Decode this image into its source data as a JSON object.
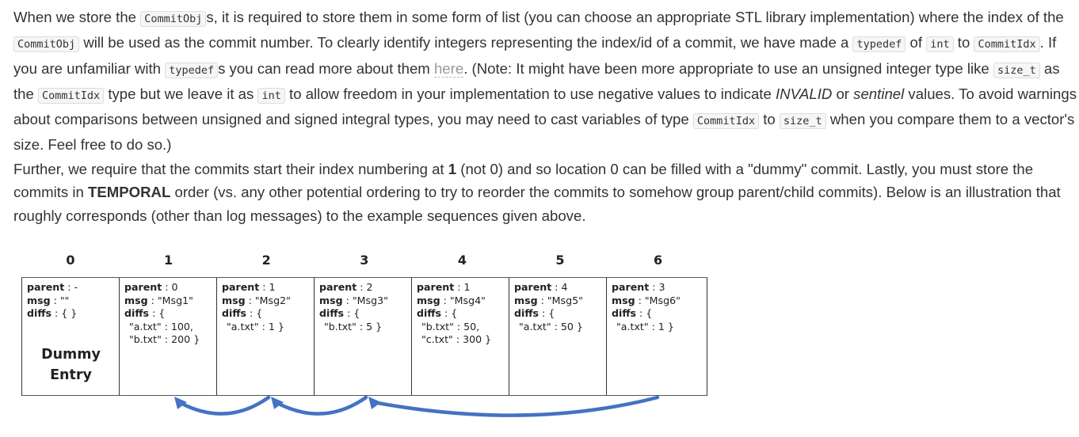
{
  "paragraph1": {
    "s1": "When we store the ",
    "c1": "CommitObj",
    "s2": "s, it is required to store them in some form of list (you can choose an appropriate STL library implementation) where the index of the ",
    "c2": "CommitObj",
    "s3": " will be used as the commit number. To clearly identify integers representing the index/id of a commit, we have made a ",
    "c3": "typedef",
    "s4": " of ",
    "c4": "int",
    "s5": " to ",
    "c5": "CommitIdx",
    "s6": ". If you are unfamiliar with ",
    "c6": "typedef",
    "s7": "s you can read more about them ",
    "link": "here",
    "s8": ". (Note: It might have been more appropriate to use an unsigned integer type like ",
    "c7": "size_t",
    "s9": " as the ",
    "c8": "CommitIdx",
    "s10": " type but we leave it as ",
    "c9": "int",
    "s11": " to allow freedom in your implementation to use negative values to indicate ",
    "i1": "INVALID",
    "s12": " or ",
    "i2": "sentinel",
    "s13": " values. To avoid warnings about comparisons between unsigned and signed integral types, you may need to cast variables of type ",
    "c10": "CommitIdx",
    "s14": " to ",
    "c11": "size_t",
    "s15": " when you compare them to a vector's size. Feel free to do so.)"
  },
  "paragraph2": {
    "s1": "Further, we require that the commits start their index numbering at ",
    "b1": "1",
    "s2": " (not 0) and so location 0 can be filled with a \"dummy\" commit. Lastly, you must store the commits in ",
    "b2": "TEMPORAL",
    "s3": " order (vs. any other potential ordering to try to reorder the commits to somehow group parent/child commits). Below is an illustration that roughly corresponds (other than log messages) to the example sequences given above."
  },
  "diagram": {
    "labels": {
      "parent": "parent",
      "msg": "msg",
      "diffs": "diffs",
      "sep": " : "
    },
    "arrow_color": "#4472c4",
    "commits": [
      {
        "index": "0",
        "parent": "-",
        "msg": "\"\"",
        "diffs_open": "{ }",
        "diffs": [],
        "note": [
          "Dummy",
          "Entry"
        ]
      },
      {
        "index": "1",
        "parent": "0",
        "msg": "\"Msg1\"",
        "diffs_open": "{",
        "diffs": [
          "\"a.txt\" : 100,",
          "\"b.txt\" : 200 }"
        ]
      },
      {
        "index": "2",
        "parent": "1",
        "msg": "\"Msg2\"",
        "diffs_open": "{",
        "diffs": [
          "\"a.txt\" : 1 }"
        ]
      },
      {
        "index": "3",
        "parent": "2",
        "msg": "\"Msg3\"",
        "diffs_open": "{",
        "diffs": [
          "\"b.txt\" : 5 }"
        ]
      },
      {
        "index": "4",
        "parent": "1",
        "msg": "\"Msg4\"",
        "diffs_open": "{",
        "diffs": [
          "\"b.txt\" : 50,",
          "\"c.txt\" : 300 }"
        ]
      },
      {
        "index": "5",
        "parent": "4",
        "msg": "\"Msg5\"",
        "diffs_open": "{",
        "diffs": [
          "\"a.txt\" : 50 }"
        ]
      },
      {
        "index": "6",
        "parent": "3",
        "msg": "\"Msg6\"",
        "diffs_open": "{",
        "diffs": [
          "\"a.txt\" : 1 }"
        ]
      }
    ],
    "arrows": [
      {
        "from": 2,
        "to": 1
      },
      {
        "from": 3,
        "to": 2
      },
      {
        "from": 6,
        "to": 3
      }
    ]
  }
}
